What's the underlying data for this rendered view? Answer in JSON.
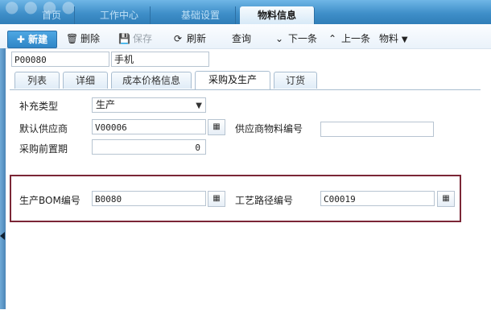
{
  "topnav": {
    "tabs": [
      "首页",
      "工作中心",
      "基础设置",
      "物料信息"
    ],
    "active": "物料信息"
  },
  "toolbar": {
    "new_label": "新建",
    "delete_label": "删除",
    "save_label": "保存",
    "refresh_label": "刷新",
    "query_label": "查询",
    "next_label": "下一条",
    "prev_label": "上一条",
    "material_label": "物料"
  },
  "record": {
    "code": "P00080",
    "name": "手机"
  },
  "subtabs": [
    "列表",
    "详细",
    "成本价格信息",
    "采购及生产",
    "订货"
  ],
  "subtab_active": "采购及生产",
  "form": {
    "supply_type_label": "补充类型",
    "supply_type_value": "生产",
    "default_supplier_label": "默认供应商",
    "default_supplier_value": "V00006",
    "supplier_item_no_label": "供应商物料编号",
    "supplier_item_no_value": "",
    "purchase_lead_label": "采购前置期",
    "purchase_lead_value": "0",
    "bom_label": "生产BOM编号",
    "bom_value": "B0080",
    "routing_label": "工艺路径编号",
    "routing_value": "C00019"
  },
  "colors": {
    "header_blue": "#3f8fc9",
    "highlight_border": "#7b2636",
    "new_button": "#2f86c7"
  }
}
